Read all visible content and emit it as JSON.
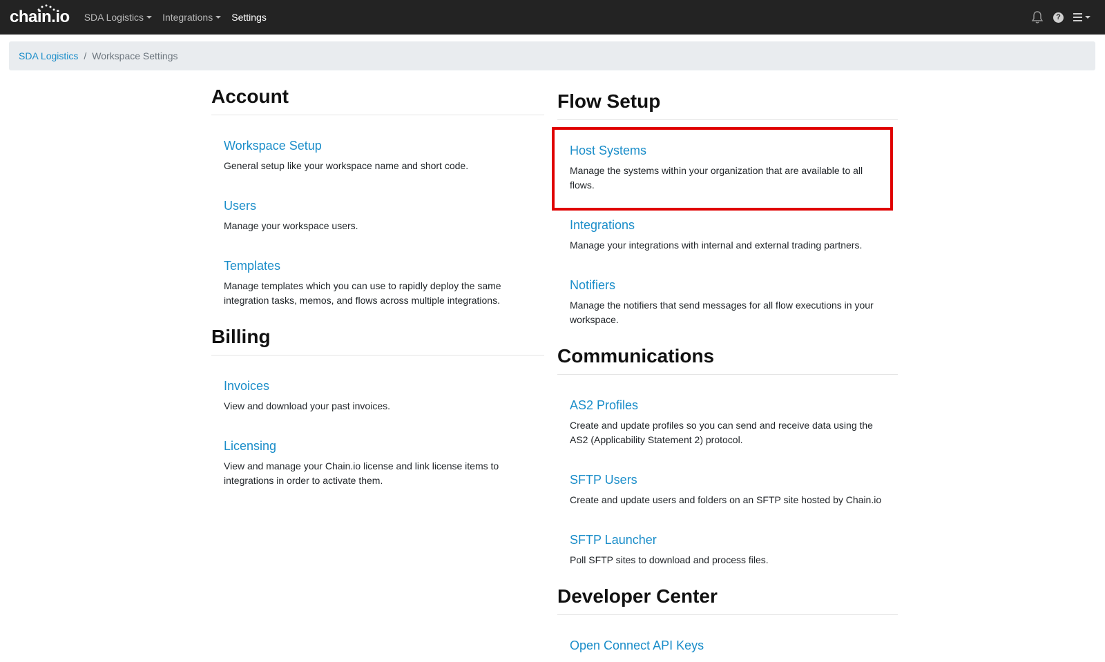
{
  "navbar": {
    "brand": "chain.io",
    "menu": [
      {
        "label": "SDA Logistics",
        "dropdown": true
      },
      {
        "label": "Integrations",
        "dropdown": true
      },
      {
        "label": "Settings",
        "dropdown": false
      }
    ],
    "icons": [
      "bell-icon",
      "help-icon",
      "hamburger-menu-icon"
    ]
  },
  "breadcrumb": {
    "items": [
      "SDA Logistics",
      "Workspace Settings"
    ],
    "separator": "/"
  },
  "left_column": {
    "sections": [
      {
        "title": "Account",
        "items": [
          {
            "label": "Workspace Setup",
            "description": "General setup like your workspace name and short code."
          },
          {
            "label": "Users",
            "description": "Manage your workspace users."
          },
          {
            "label": "Templates",
            "description": "Manage templates which you can use to rapidly deploy the same integration tasks, memos, and flows across multiple integrations."
          }
        ]
      },
      {
        "title": "Billing",
        "items": [
          {
            "label": "Invoices",
            "description": "View and download your past invoices."
          },
          {
            "label": "Licensing",
            "description": "View and manage your Chain.io license and link license items to integrations in order to activate them."
          }
        ]
      }
    ]
  },
  "right_column": {
    "sections": [
      {
        "title": "Flow Setup",
        "items": [
          {
            "label": "Host Systems",
            "description": "Manage the systems within your organization that are available to all flows."
          },
          {
            "label": "Integrations",
            "description": "Manage your integrations with internal and external trading partners."
          },
          {
            "label": "Notifiers",
            "description": "Manage the notifiers that send messages for all flow executions in your workspace."
          }
        ]
      },
      {
        "title": "Communications",
        "items": [
          {
            "label": "AS2 Profiles",
            "description": "Create and update profiles so you can send and receive data using the AS2 (Applicability Statement 2) protocol."
          },
          {
            "label": "SFTP Users",
            "description": "Create and update users and folders on an SFTP site hosted by Chain.io"
          },
          {
            "label": "SFTP Launcher",
            "description": "Poll SFTP sites to download and process files."
          }
        ]
      },
      {
        "title": "Developer Center",
        "items": [
          {
            "label": "Open Connect API Keys",
            "description": ""
          }
        ]
      }
    ]
  },
  "highlight": {
    "target": "Host Systems",
    "color": "#e00000"
  },
  "colors": {
    "navbar_bg": "#232323",
    "link": "#1a8dc9",
    "breadcrumb_bg": "#e9ecef"
  }
}
